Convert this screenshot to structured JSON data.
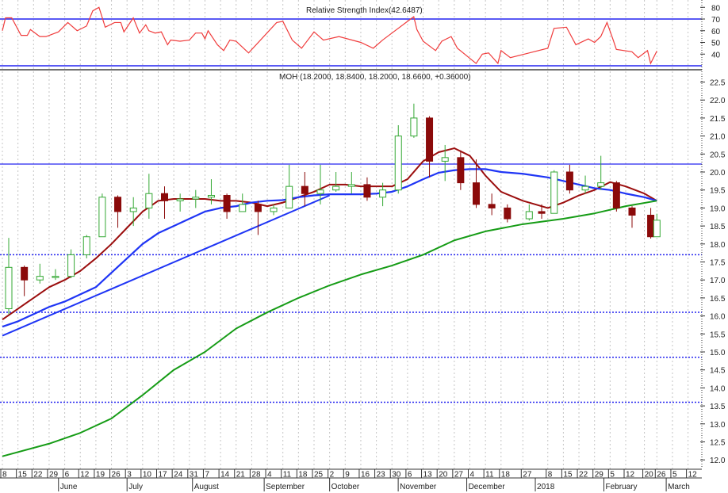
{
  "rsi_panel": {
    "title": "Relative Strength Index(42.6487)",
    "levels": [
      70,
      30
    ],
    "ticks": [
      "80",
      "70",
      "60",
      "50",
      "40"
    ]
  },
  "price_panel": {
    "title": "MOH (18.2000, 18.8400, 18.2000, 18.6600, +0.36000)"
  },
  "colors": {
    "up_candle": "#34a834",
    "down_candle": "#8b0a0a",
    "ma_short": "#9b0d0d",
    "ma_mid": "#1f35f5",
    "ma_long": "#169c16",
    "level_line": "#2424f0",
    "rsi_line": "#f03c3c",
    "grid": "#c4c4c4"
  },
  "chart_data": [
    {
      "type": "line",
      "title": "Relative Strength Index(42.6487)",
      "ylim": [
        30,
        85
      ],
      "grid": true,
      "reference_lines": [
        70,
        30
      ],
      "x": [
        "2017-05-08",
        "2017-05-09",
        "2017-05-11",
        "2017-05-16",
        "2017-05-18",
        "2017-05-19",
        "2017-05-24",
        "2017-05-26",
        "2017-06-01",
        "2017-06-06",
        "2017-06-09",
        "2017-06-14",
        "2017-06-16",
        "2017-06-20",
        "2017-06-22",
        "2017-06-27",
        "2017-06-29",
        "2017-06-30",
        "2017-07-05",
        "2017-07-07",
        "2017-07-11",
        "2017-07-12",
        "2017-07-14",
        "2017-07-18",
        "2017-07-20",
        "2017-07-21",
        "2017-07-26",
        "2017-07-31",
        "2017-08-02",
        "2017-08-04",
        "2017-08-07",
        "2017-08-08",
        "2017-08-11",
        "2017-08-15",
        "2017-08-17",
        "2017-08-21",
        "2017-08-25",
        "2017-09-07",
        "2017-09-11",
        "2017-09-14",
        "2017-09-19",
        "2017-09-25",
        "2017-09-28",
        "2017-10-05",
        "2017-10-16",
        "2017-10-20",
        "2017-10-25",
        "2017-10-30",
        "2017-11-03",
        "2017-11-08",
        "2017-11-09",
        "2017-11-13",
        "2017-11-17",
        "2017-11-21",
        "2017-11-24",
        "2017-11-28",
        "2017-12-06",
        "2017-12-08",
        "2017-12-12",
        "2017-12-15",
        "2017-12-18",
        "2017-12-21",
        "2017-12-29",
        "2018-01-08",
        "2018-01-10",
        "2018-01-16",
        "2018-01-19",
        "2018-01-25",
        "2018-01-29",
        "2018-01-31",
        "2018-02-02",
        "2018-02-06",
        "2018-02-07",
        "2018-02-14",
        "2018-02-16",
        "2018-02-21",
        "2018-02-22",
        "2018-02-26"
      ],
      "values": [
        60,
        71,
        71,
        56,
        56,
        61,
        55,
        55,
        59,
        67,
        60,
        64,
        77,
        80,
        63,
        67,
        67,
        59,
        71,
        58,
        65,
        60,
        58,
        59,
        48,
        52,
        51,
        52,
        58,
        58,
        53,
        60,
        48,
        43,
        52,
        51,
        41,
        67,
        68,
        52,
        45,
        59,
        52,
        55,
        50,
        45,
        52,
        58,
        66,
        72,
        61,
        51,
        43,
        51,
        55,
        45,
        32,
        40,
        41,
        32,
        43,
        37,
        41,
        45,
        62,
        63,
        48,
        53,
        50,
        55,
        67,
        52,
        44,
        42,
        37,
        43,
        32,
        42.6487
      ]
    },
    {
      "type": "candlestick",
      "title": "MOH (18.2000, 18.8400, 18.2000, 18.6600, +0.36000)",
      "ylim": [
        11.8,
        22.8
      ],
      "y_ticks": [
        "12.0",
        "12.5",
        "13.0",
        "13.5",
        "14.0",
        "14.5",
        "15.0",
        "15.5",
        "16.0",
        "16.5",
        "17.0",
        "17.5",
        "18.0",
        "18.5",
        "19.0",
        "19.5",
        "20.0",
        "20.5",
        "21.0",
        "21.5",
        "22.0",
        "22.5"
      ],
      "grid": true,
      "candles": [
        {
          "date": "2017-05-08",
          "o": 16.2,
          "h": 18.17,
          "l": 16.05,
          "c": 17.35
        },
        {
          "date": "2017-05-15",
          "o": 17.35,
          "h": 17.4,
          "l": 16.55,
          "c": 17.0
        },
        {
          "date": "2017-05-22",
          "o": 17.0,
          "h": 17.45,
          "l": 16.9,
          "c": 17.1
        },
        {
          "date": "2017-05-29",
          "o": 17.1,
          "h": 17.3,
          "l": 17.0,
          "c": 17.1
        },
        {
          "date": "2017-06-05",
          "o": 17.1,
          "h": 17.85,
          "l": 17.05,
          "c": 17.7
        },
        {
          "date": "2017-06-12",
          "o": 17.7,
          "h": 18.25,
          "l": 17.6,
          "c": 18.2
        },
        {
          "date": "2017-06-19",
          "o": 18.2,
          "h": 19.4,
          "l": 18.2,
          "c": 19.3
        },
        {
          "date": "2017-06-26",
          "o": 19.3,
          "h": 19.35,
          "l": 18.45,
          "c": 18.9
        },
        {
          "date": "2017-07-03",
          "o": 18.9,
          "h": 19.3,
          "l": 18.5,
          "c": 19.0
        },
        {
          "date": "2017-07-10",
          "o": 19.0,
          "h": 19.95,
          "l": 18.7,
          "c": 19.4
        },
        {
          "date": "2017-07-17",
          "o": 19.4,
          "h": 19.6,
          "l": 18.7,
          "c": 19.2
        },
        {
          "date": "2017-07-24",
          "o": 19.2,
          "h": 19.4,
          "l": 18.9,
          "c": 19.25
        },
        {
          "date": "2017-07-31",
          "o": 19.25,
          "h": 19.5,
          "l": 19.0,
          "c": 19.3
        },
        {
          "date": "2017-08-07",
          "o": 19.3,
          "h": 19.8,
          "l": 19.1,
          "c": 19.35
        },
        {
          "date": "2017-08-14",
          "o": 19.35,
          "h": 19.4,
          "l": 18.7,
          "c": 18.9
        },
        {
          "date": "2017-08-21",
          "o": 18.9,
          "h": 19.4,
          "l": 18.9,
          "c": 19.1
        },
        {
          "date": "2017-08-28",
          "o": 19.1,
          "h": 19.2,
          "l": 18.25,
          "c": 18.9
        },
        {
          "date": "2017-09-04",
          "o": 18.9,
          "h": 19.1,
          "l": 18.8,
          "c": 19.0
        },
        {
          "date": "2017-09-11",
          "o": 19.0,
          "h": 20.2,
          "l": 19.0,
          "c": 19.6
        },
        {
          "date": "2017-09-18",
          "o": 19.6,
          "h": 20.0,
          "l": 19.05,
          "c": 19.4
        },
        {
          "date": "2017-09-25",
          "o": 19.4,
          "h": 20.2,
          "l": 19.1,
          "c": 19.5
        },
        {
          "date": "2017-10-02",
          "o": 19.5,
          "h": 20.0,
          "l": 19.45,
          "c": 19.6
        },
        {
          "date": "2017-10-09",
          "o": 19.6,
          "h": 20.0,
          "l": 19.4,
          "c": 19.65
        },
        {
          "date": "2017-10-16",
          "o": 19.65,
          "h": 19.85,
          "l": 19.2,
          "c": 19.3
        },
        {
          "date": "2017-10-23",
          "o": 19.3,
          "h": 19.7,
          "l": 19.05,
          "c": 19.5
        },
        {
          "date": "2017-10-30",
          "o": 19.5,
          "h": 21.3,
          "l": 19.4,
          "c": 21.0
        },
        {
          "date": "2017-11-06",
          "o": 21.0,
          "h": 21.9,
          "l": 20.95,
          "c": 21.5
        },
        {
          "date": "2017-11-13",
          "o": 21.5,
          "h": 21.55,
          "l": 19.85,
          "c": 20.3
        },
        {
          "date": "2017-11-20",
          "o": 20.3,
          "h": 20.75,
          "l": 19.75,
          "c": 20.4
        },
        {
          "date": "2017-11-27",
          "o": 20.4,
          "h": 20.6,
          "l": 19.5,
          "c": 19.7
        },
        {
          "date": "2017-12-04",
          "o": 19.7,
          "h": 20.35,
          "l": 19.0,
          "c": 19.1
        },
        {
          "date": "2017-12-11",
          "o": 19.1,
          "h": 19.4,
          "l": 18.8,
          "c": 19.0
        },
        {
          "date": "2017-12-18",
          "o": 19.0,
          "h": 19.1,
          "l": 18.6,
          "c": 18.7
        },
        {
          "date": "2017-12-27",
          "o": 18.7,
          "h": 19.1,
          "l": 18.65,
          "c": 18.9
        },
        {
          "date": "2018-01-02",
          "o": 18.9,
          "h": 19.1,
          "l": 18.7,
          "c": 18.85
        },
        {
          "date": "2018-01-08",
          "o": 18.85,
          "h": 20.05,
          "l": 18.85,
          "c": 20.0
        },
        {
          "date": "2018-01-15",
          "o": 20.0,
          "h": 20.2,
          "l": 19.4,
          "c": 19.5
        },
        {
          "date": "2018-01-22",
          "o": 19.5,
          "h": 19.9,
          "l": 19.4,
          "c": 19.6
        },
        {
          "date": "2018-01-29",
          "o": 19.6,
          "h": 20.45,
          "l": 19.5,
          "c": 19.7
        },
        {
          "date": "2018-02-05",
          "o": 19.7,
          "h": 19.75,
          "l": 18.9,
          "c": 19.0
        },
        {
          "date": "2018-02-12",
          "o": 19.0,
          "h": 19.05,
          "l": 18.45,
          "c": 18.8
        },
        {
          "date": "2018-02-20",
          "o": 18.8,
          "h": 19.0,
          "l": 18.15,
          "c": 18.2
        },
        {
          "date": "2018-02-26",
          "o": 18.2,
          "h": 18.84,
          "l": 18.2,
          "c": 18.66
        }
      ],
      "moving_averages": [
        {
          "key": "ma_short",
          "x": [
            "2017-05-08",
            "2017-05-15",
            "2017-05-22",
            "2017-05-29",
            "2017-06-05",
            "2017-06-12",
            "2017-06-19",
            "2017-06-26",
            "2017-07-03",
            "2017-07-10",
            "2017-07-17",
            "2017-07-24",
            "2017-07-31",
            "2017-08-07",
            "2017-08-14",
            "2017-08-21",
            "2017-08-28",
            "2017-09-04",
            "2017-09-11",
            "2017-09-18",
            "2017-09-25",
            "2017-10-02",
            "2017-10-09",
            "2017-10-16",
            "2017-10-23",
            "2017-10-30",
            "2017-11-06",
            "2017-11-13",
            "2017-11-20",
            "2017-11-27",
            "2017-12-04",
            "2017-12-11",
            "2017-12-18",
            "2017-12-27",
            "2018-01-08",
            "2018-01-15",
            "2018-01-22",
            "2018-01-29",
            "2018-02-05",
            "2018-02-12",
            "2018-02-20",
            "2018-02-26"
          ],
          "values": [
            15.9,
            16.2,
            16.5,
            16.8,
            17.0,
            17.25,
            17.6,
            18.0,
            18.45,
            18.9,
            19.2,
            19.25,
            19.25,
            19.25,
            19.2,
            19.2,
            19.15,
            19.05,
            19.15,
            19.3,
            19.45,
            19.65,
            19.65,
            19.6,
            19.6,
            19.6,
            19.8,
            20.3,
            20.55,
            20.66,
            20.45,
            19.9,
            19.45,
            19.2,
            19.0,
            19.15,
            19.35,
            19.5,
            19.72,
            19.6,
            19.4,
            19.2
          ]
        },
        {
          "key": "ma_mid",
          "x": [
            "2017-05-08",
            "2017-05-15",
            "2017-05-22",
            "2017-05-29",
            "2017-06-05",
            "2017-06-12",
            "2017-06-19",
            "2017-06-26",
            "2017-07-03",
            "2017-07-10",
            "2017-07-17",
            "2017-07-24",
            "2017-07-31",
            "2017-08-07",
            "2017-08-14",
            "2017-08-21",
            "2017-08-28",
            "2017-09-04",
            "2017-09-11",
            "2017-09-18",
            "2017-09-25",
            "2017-10-02",
            "2017-10-09",
            "2017-10-16",
            "2017-10-23",
            "2017-10-30",
            "2017-11-06",
            "2017-11-13",
            "2017-11-20",
            "2017-11-27",
            "2017-12-04",
            "2017-12-11",
            "2017-12-18",
            "2017-12-27",
            "2018-01-08",
            "2018-01-15",
            "2018-01-22",
            "2018-01-29",
            "2018-02-05",
            "2018-02-12",
            "2018-02-20",
            "2018-02-26"
          ],
          "values": [
            15.7,
            15.85,
            16.05,
            16.25,
            16.4,
            16.6,
            16.8,
            17.2,
            17.6,
            18.0,
            18.3,
            18.5,
            18.7,
            18.9,
            19.0,
            19.05,
            19.15,
            19.2,
            19.22,
            19.3,
            19.35,
            19.38,
            19.38,
            19.38,
            19.4,
            19.45,
            19.6,
            19.8,
            19.98,
            20.05,
            20.08,
            20.08,
            20.0,
            19.95,
            19.85,
            19.75,
            19.65,
            19.55,
            19.5,
            19.4,
            19.3,
            19.2
          ]
        },
        {
          "key": "ma_long",
          "x": [
            "2017-05-08",
            "2017-05-29",
            "2017-06-12",
            "2017-06-26",
            "2017-07-10",
            "2017-07-24",
            "2017-08-07",
            "2017-08-21",
            "2017-09-04",
            "2017-09-18",
            "2017-10-02",
            "2017-10-16",
            "2017-10-30",
            "2017-11-13",
            "2017-11-27",
            "2017-12-11",
            "2017-12-27",
            "2018-01-15",
            "2018-01-29",
            "2018-02-12",
            "2018-02-26"
          ],
          "values": [
            12.1,
            12.45,
            12.75,
            13.15,
            13.8,
            14.5,
            15.0,
            15.65,
            16.1,
            16.5,
            16.85,
            17.15,
            17.4,
            17.7,
            18.1,
            18.35,
            18.55,
            18.7,
            18.85,
            19.05,
            19.2
          ]
        }
      ],
      "horizontal_lines": [
        {
          "value": 20.22,
          "style": "solid"
        },
        {
          "value": 17.7,
          "style": "dotted"
        },
        {
          "value": 16.1,
          "style": "dotted"
        },
        {
          "value": 14.85,
          "style": "dotted"
        },
        {
          "value": 13.6,
          "style": "dotted"
        }
      ],
      "trendline": {
        "from": {
          "date": "2017-05-08",
          "value": 15.45
        },
        "to": {
          "date": "2017-10-02",
          "value": 19.35
        }
      }
    }
  ],
  "x_axis": {
    "ticks": [
      {
        "date": "2017-05-08",
        "label": "8"
      },
      {
        "date": "2017-05-15",
        "label": "15"
      },
      {
        "date": "2017-05-22",
        "label": "22"
      },
      {
        "date": "2017-05-29",
        "label": "29"
      },
      {
        "date": "2017-06-05",
        "label": "6"
      },
      {
        "date": "2017-06-12",
        "label": "12"
      },
      {
        "date": "2017-06-19",
        "label": "19"
      },
      {
        "date": "2017-06-26",
        "label": "26"
      },
      {
        "date": "2017-07-03",
        "label": "3"
      },
      {
        "date": "2017-07-10",
        "label": "10"
      },
      {
        "date": "2017-07-17",
        "label": "17"
      },
      {
        "date": "2017-07-24",
        "label": "24"
      },
      {
        "date": "2017-07-31",
        "label": "31"
      },
      {
        "date": "2017-08-07",
        "label": "7"
      },
      {
        "date": "2017-08-14",
        "label": "14"
      },
      {
        "date": "2017-08-21",
        "label": "21"
      },
      {
        "date": "2017-08-28",
        "label": "28"
      },
      {
        "date": "2017-09-04",
        "label": "4"
      },
      {
        "date": "2017-09-11",
        "label": "11"
      },
      {
        "date": "2017-09-18",
        "label": "18"
      },
      {
        "date": "2017-09-25",
        "label": "25"
      },
      {
        "date": "2017-10-02",
        "label": "2"
      },
      {
        "date": "2017-10-09",
        "label": "9"
      },
      {
        "date": "2017-10-16",
        "label": "16"
      },
      {
        "date": "2017-10-23",
        "label": "23"
      },
      {
        "date": "2017-10-30",
        "label": "30"
      },
      {
        "date": "2017-11-06",
        "label": "6"
      },
      {
        "date": "2017-11-13",
        "label": "13"
      },
      {
        "date": "2017-11-20",
        "label": "20"
      },
      {
        "date": "2017-11-27",
        "label": "27"
      },
      {
        "date": "2017-12-04",
        "label": "4"
      },
      {
        "date": "2017-12-11",
        "label": "11"
      },
      {
        "date": "2017-12-18",
        "label": "18"
      },
      {
        "date": "2017-12-27",
        "label": "27"
      },
      {
        "date": "2018-01-08",
        "label": "8"
      },
      {
        "date": "2018-01-15",
        "label": "15"
      },
      {
        "date": "2018-01-22",
        "label": "22"
      },
      {
        "date": "2018-01-29",
        "label": "29"
      },
      {
        "date": "2018-02-05",
        "label": "5"
      },
      {
        "date": "2018-02-12",
        "label": "12"
      },
      {
        "date": "2018-02-20",
        "label": "20"
      },
      {
        "date": "2018-02-26",
        "label": "26"
      },
      {
        "date": "2018-03-05",
        "label": "5"
      },
      {
        "date": "2018-03-12",
        "label": "12"
      }
    ],
    "months": [
      {
        "date": "2017-06-01",
        "label": "June"
      },
      {
        "date": "2017-07-03",
        "label": "July"
      },
      {
        "date": "2017-08-01",
        "label": "August"
      },
      {
        "date": "2017-09-01",
        "label": "September"
      },
      {
        "date": "2017-10-02",
        "label": "October"
      },
      {
        "date": "2017-11-01",
        "label": "November"
      },
      {
        "date": "2017-12-01",
        "label": "December"
      },
      {
        "date": "2018-01-02",
        "label": "2018"
      },
      {
        "date": "2018-02-01",
        "label": "February"
      },
      {
        "date": "2018-03-01",
        "label": "March"
      }
    ]
  }
}
